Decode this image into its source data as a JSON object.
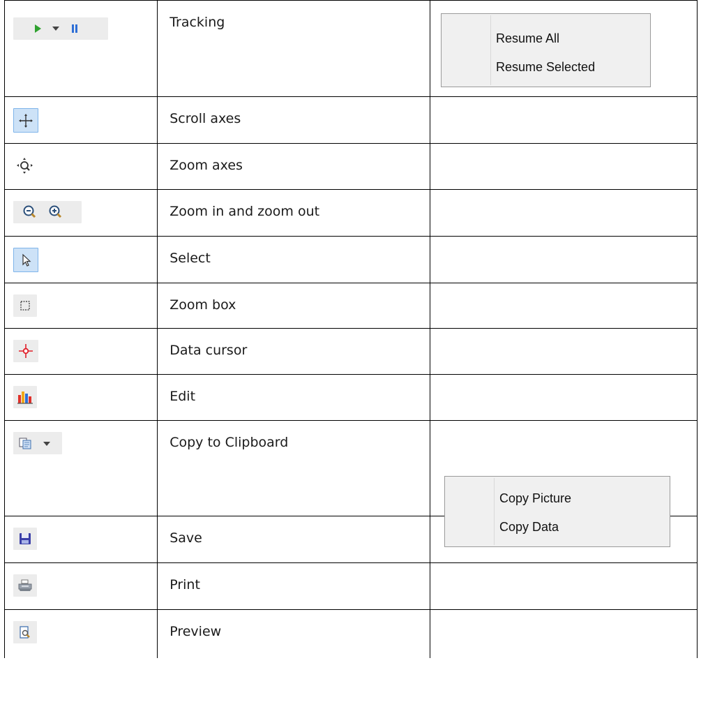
{
  "rows": [
    {
      "label": "Tracking",
      "icons": [
        "play-icon",
        "dropdown-arrow-icon",
        "pause-icon"
      ]
    },
    {
      "label": "Scroll axes",
      "icons": [
        "move-axes-icon"
      ]
    },
    {
      "label": "Zoom axes",
      "icons": [
        "zoom-axes-icon"
      ]
    },
    {
      "label": "Zoom in and zoom out",
      "icons": [
        "zoom-in-icon",
        "zoom-out-icon"
      ]
    },
    {
      "label": "Select",
      "icons": [
        "select-pointer-icon"
      ]
    },
    {
      "label": "Zoom box",
      "icons": [
        "zoom-box-icon"
      ]
    },
    {
      "label": "Data cursor",
      "icons": [
        "data-cursor-icon"
      ]
    },
    {
      "label": "Edit",
      "icons": [
        "edit-chart-icon"
      ]
    },
    {
      "label": "Copy to Clipboard",
      "icons": [
        "copy-icon",
        "dropdown-arrow-icon"
      ]
    },
    {
      "label": "Save",
      "icons": [
        "save-icon"
      ]
    },
    {
      "label": "Print",
      "icons": [
        "print-icon"
      ]
    },
    {
      "label": "Preview",
      "icons": [
        "preview-icon"
      ]
    }
  ],
  "menus": {
    "tracking": {
      "items": [
        "Resume All",
        "Resume Selected"
      ]
    },
    "copy": {
      "items": [
        "Copy Picture",
        "Copy Data"
      ]
    }
  },
  "colors": {
    "selected_bg": "#cde2f7",
    "selected_border": "#7eb4ea",
    "play_green": "#2fa12f",
    "pause_blue": "#2e6fd6",
    "cursor_red": "#e0202a"
  }
}
